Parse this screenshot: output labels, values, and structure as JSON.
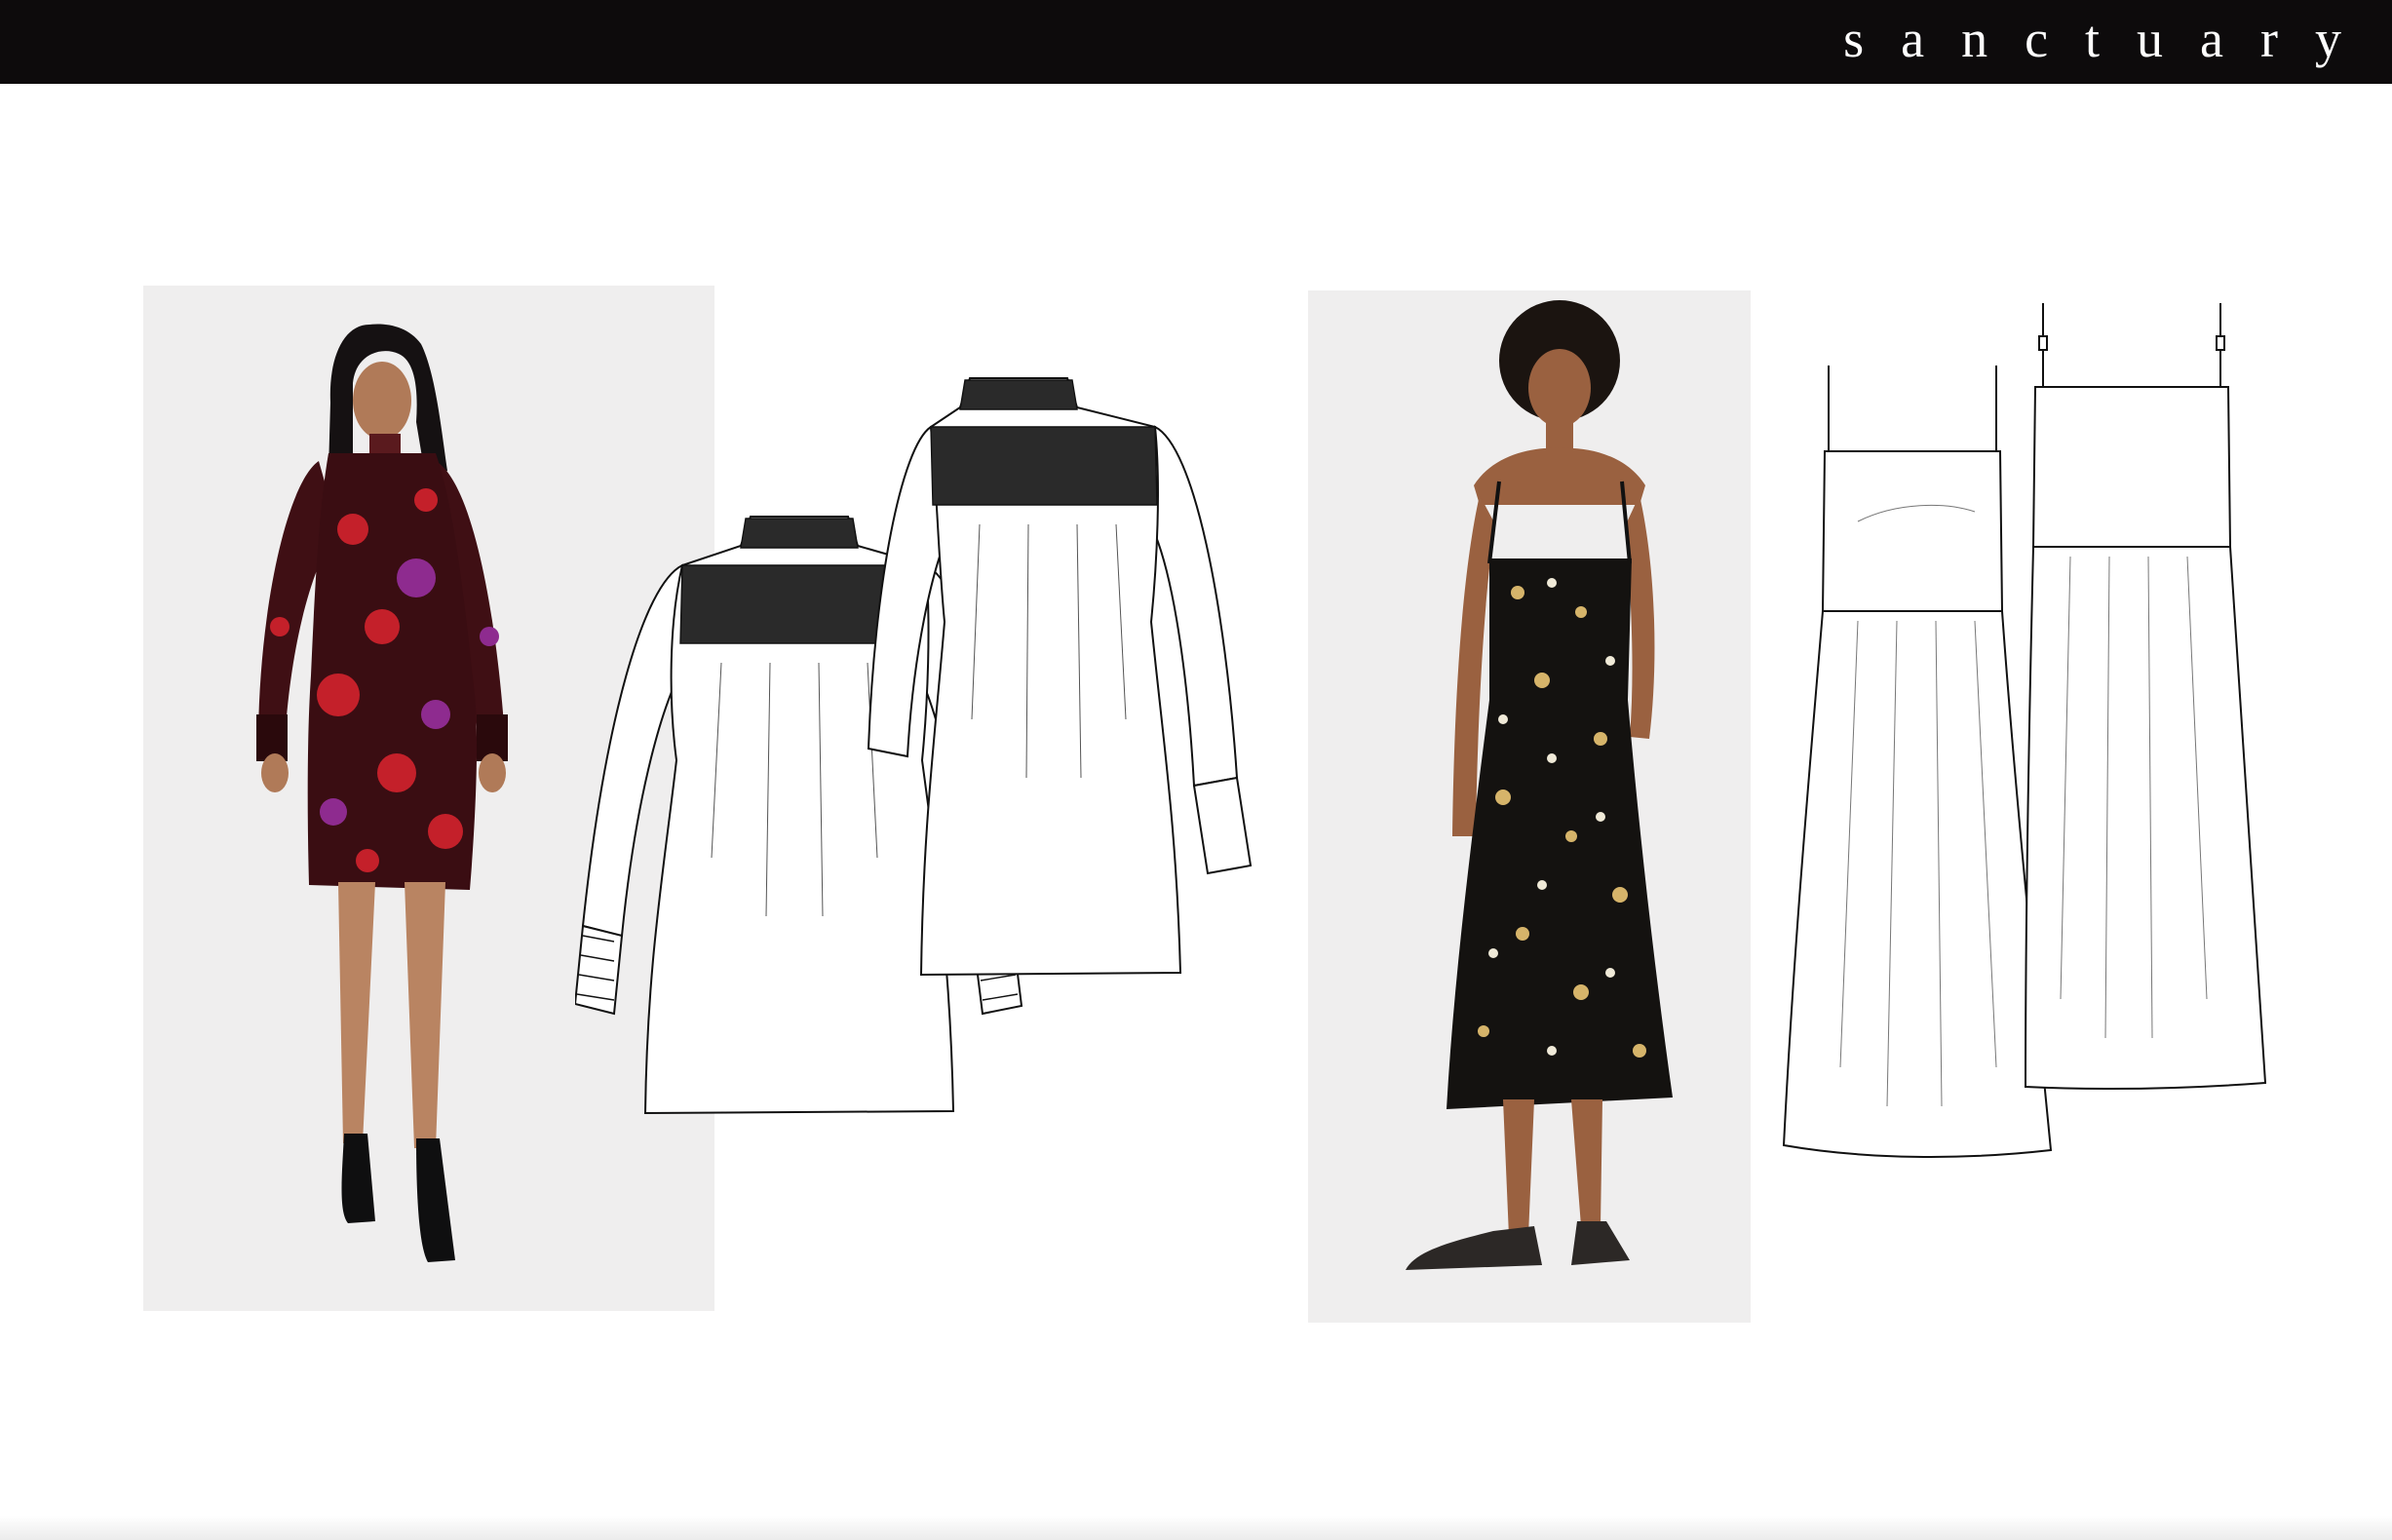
{
  "header": {
    "brand_name": "sanctuary",
    "background_color": "#0d0b0c",
    "text_color": "#ffffff"
  },
  "looks": [
    {
      "photo_icon": "model-photo-floral-mini-dress",
      "flat_front_icon": "technical-sketch-smocked-dress-front",
      "flat_back_icon": "technical-sketch-smocked-dress-back",
      "print_colors": [
        "#3a0d12",
        "#c4202a",
        "#8e2b8f"
      ]
    },
    {
      "photo_icon": "model-photo-floral-slip-midi-dress",
      "flat_front_icon": "technical-sketch-slip-dress-front",
      "flat_back_icon": "technical-sketch-slip-dress-back",
      "print_colors": [
        "#141210",
        "#d6b46a",
        "#f0ead8"
      ]
    }
  ]
}
